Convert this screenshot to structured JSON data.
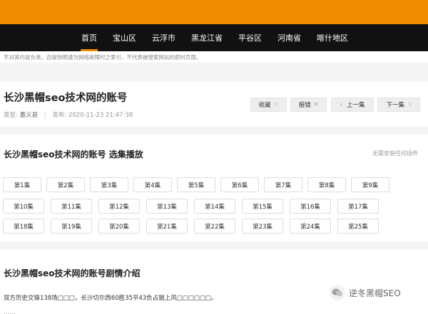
{
  "nav": {
    "items": [
      "首页",
      "宝山区",
      "云浮市",
      "黑龙江省",
      "平谷区",
      "河南省",
      "喀什地区"
    ],
    "active_index": 0
  },
  "disclaimer": "不对其内容负责。百度快照谨为网络故障时之索引，不代表被搜索网站的即时页面。",
  "header": {
    "title": "长沙黑帽seo技术网的账号",
    "type_label": "类型:",
    "type_value": "嘉义县",
    "date_label": "发布:",
    "date_value": "2020-11-23 21:47:38",
    "buttons": {
      "favorite": "收藏",
      "report": "报错",
      "prev": "上一集",
      "next": "下一集"
    }
  },
  "episodes": {
    "title": "长沙黑帽seo技术网的账号 选集播放",
    "note": "无需安装任何插件",
    "row1": [
      "第1集",
      "第2集",
      "第3集",
      "第4集",
      "第5集",
      "第6集",
      "第7集",
      "第8集",
      "第9集"
    ],
    "row2": [
      "第10集",
      "第11集",
      "第12集",
      "第13集",
      "第14集",
      "第15集",
      "第16集",
      "第17集"
    ],
    "row3": [
      "第18集",
      "第19集",
      "第20集",
      "第21集",
      "第22集",
      "第23集",
      "第24集",
      "第25集"
    ]
  },
  "intro": {
    "title": "长沙黑帽seo技术网的账号剧情介绍",
    "text": "双方历史交锋138场□□□，长沙切尔西60胜35平43负占据上风□□□□□□。",
    "text2": "……"
  },
  "watermark": {
    "text": "逆冬黑帽SEO",
    "icon": "wechat-icon"
  },
  "colors": {
    "accent": "#f08c00",
    "nav_bg": "#111111",
    "page_bg": "#f4f4f4"
  }
}
